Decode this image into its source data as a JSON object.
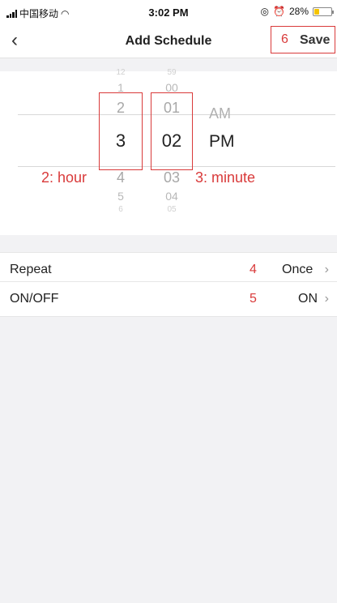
{
  "status_bar": {
    "carrier": "中国移动",
    "time": "3:02 PM",
    "battery_text": "28%",
    "battery_level": 0.28
  },
  "nav": {
    "back_icon": "chevron-left-icon",
    "title": "Add Schedule",
    "save_label": "Save",
    "save_annotation": "6"
  },
  "picker": {
    "hours": [
      "12",
      "1",
      "2",
      "3",
      "4",
      "5",
      "6"
    ],
    "minutes": [
      "59",
      "00",
      "01",
      "02",
      "03",
      "04",
      "05"
    ],
    "ampm": [
      "AM",
      "PM"
    ],
    "selected_hour": "3",
    "selected_minute": "02",
    "selected_ampm": "PM",
    "hour_annotation": "2: hour",
    "minute_annotation": "3: minute"
  },
  "rows": {
    "repeat": {
      "label": "Repeat",
      "annotation": "4",
      "value": "Once"
    },
    "onoff": {
      "label": "ON/OFF",
      "annotation": "5",
      "value": "ON"
    }
  },
  "colors": {
    "annotation": "#d93a3a",
    "background": "#f2f2f4",
    "battery": "#f5c400"
  }
}
